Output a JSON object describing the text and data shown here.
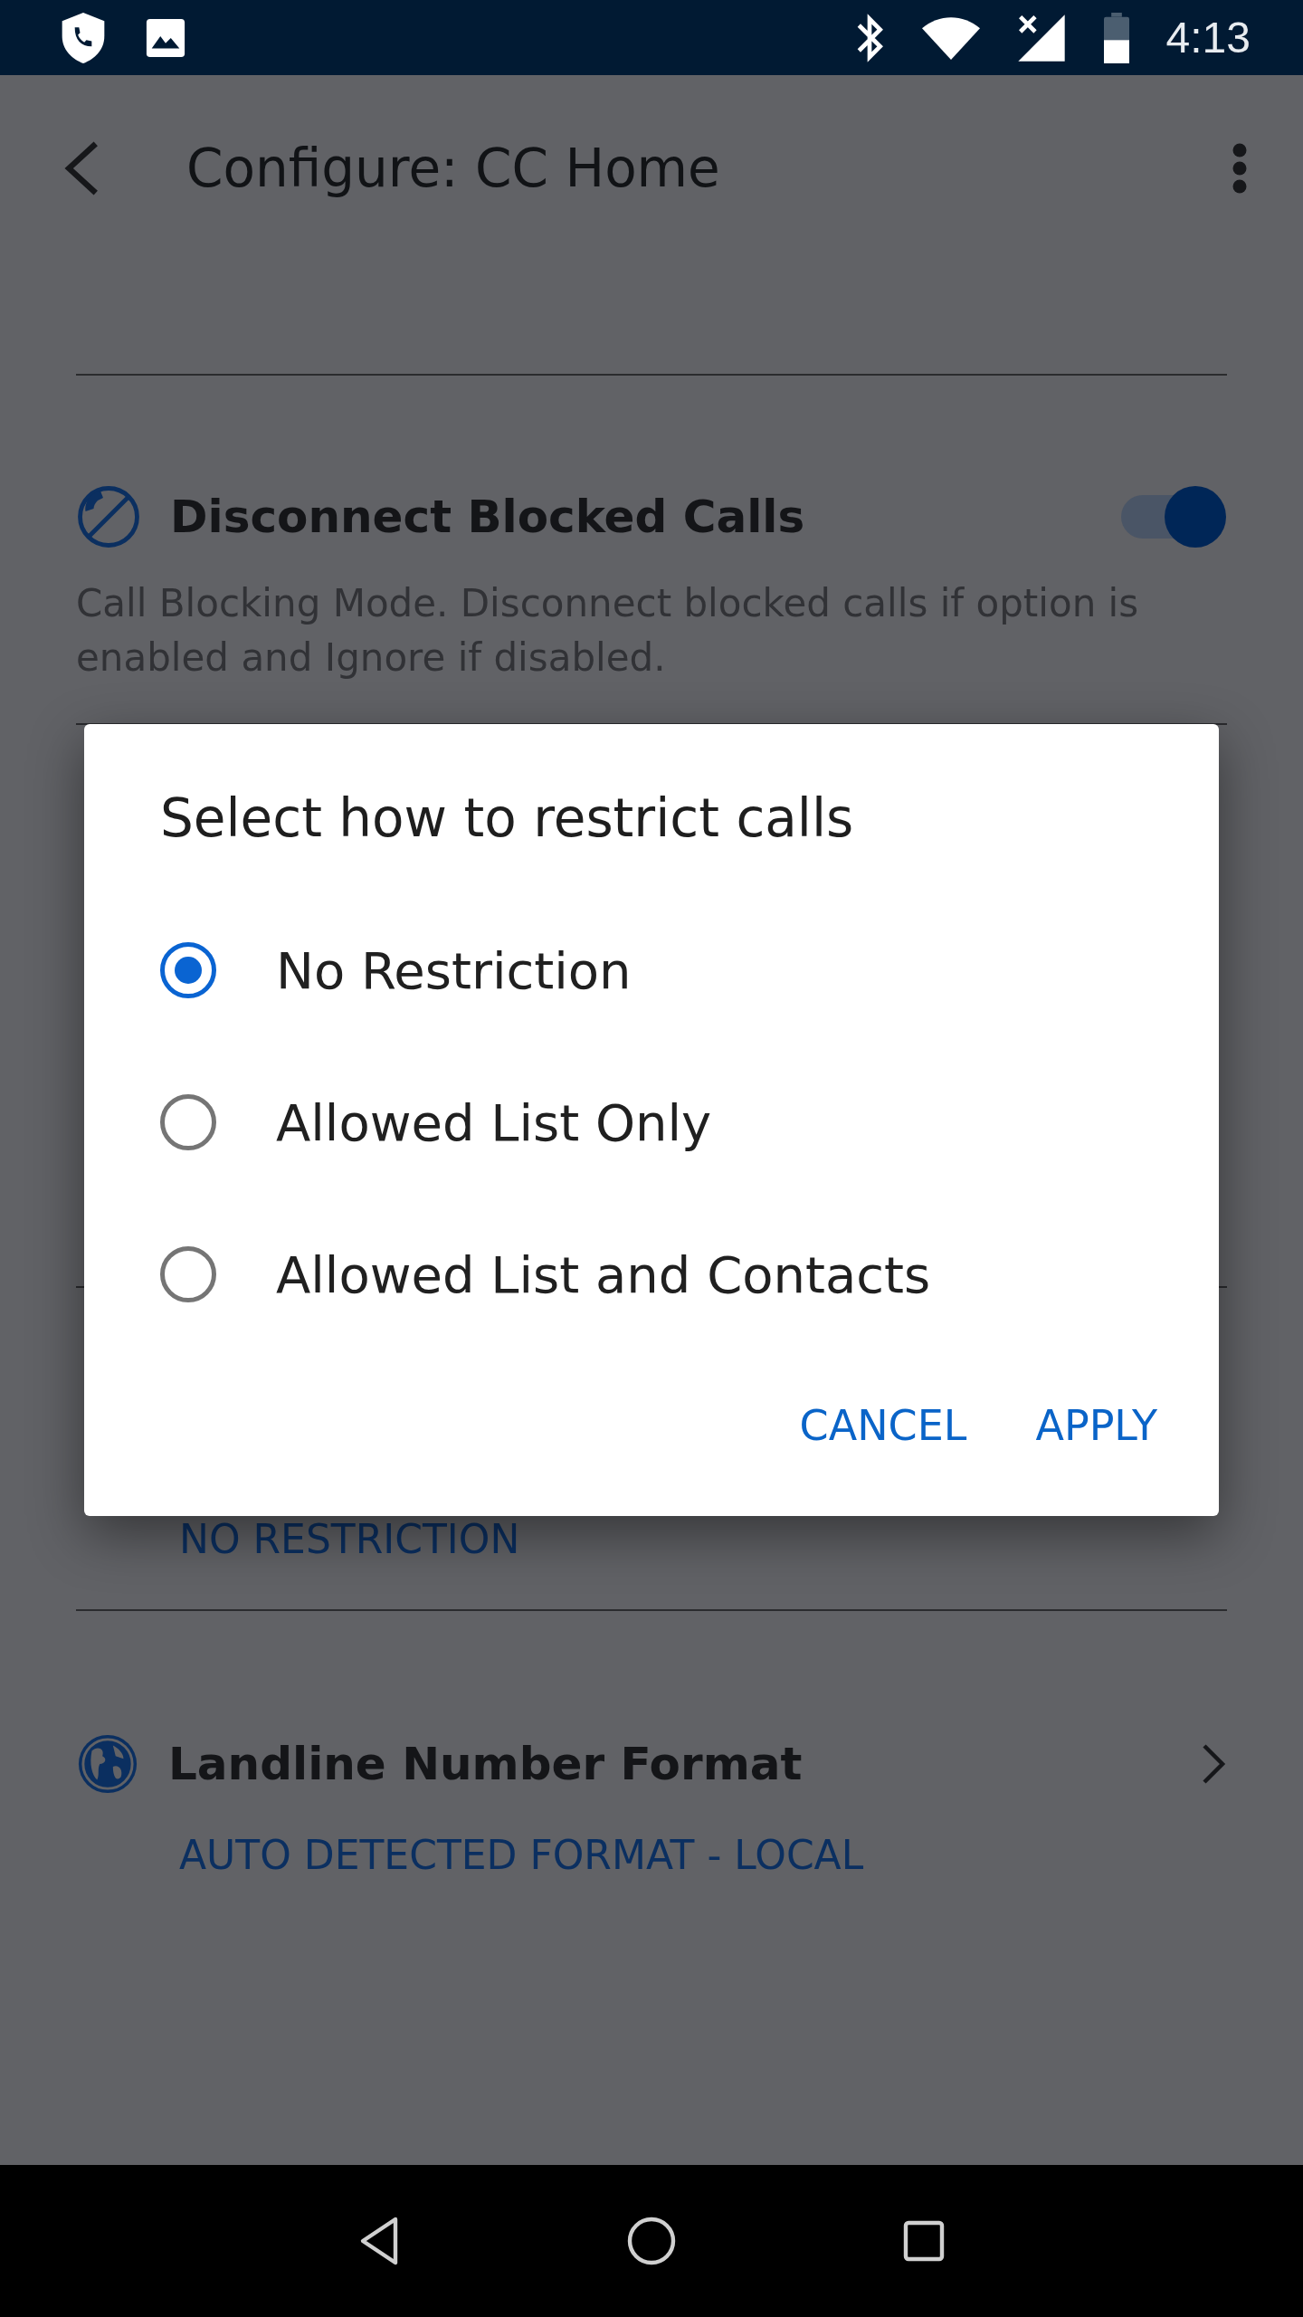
{
  "status_bar": {
    "time": "4:13"
  },
  "app_bar": {
    "title": "Configure: CC Home"
  },
  "settings": [
    {
      "kind": "toggle",
      "title": "Disconnect Blocked Calls",
      "description": "Call Blocking Mode. Disconnect blocked calls if option is enabled and Ignore if disabled.",
      "on": true
    },
    {
      "kind": "covered"
    },
    {
      "kind": "value",
      "value": "NO RESTRICTION"
    },
    {
      "kind": "link",
      "title": "Landline Number Format",
      "value": "AUTO DETECTED FORMAT - LOCAL"
    }
  ],
  "dialog": {
    "title": "Select how to restrict calls",
    "options": [
      {
        "label": "No Restriction",
        "selected": true
      },
      {
        "label": "Allowed List Only",
        "selected": false
      },
      {
        "label": "Allowed List and Contacts",
        "selected": false
      }
    ],
    "buttons": [
      "CANCEL",
      "APPLY"
    ]
  }
}
